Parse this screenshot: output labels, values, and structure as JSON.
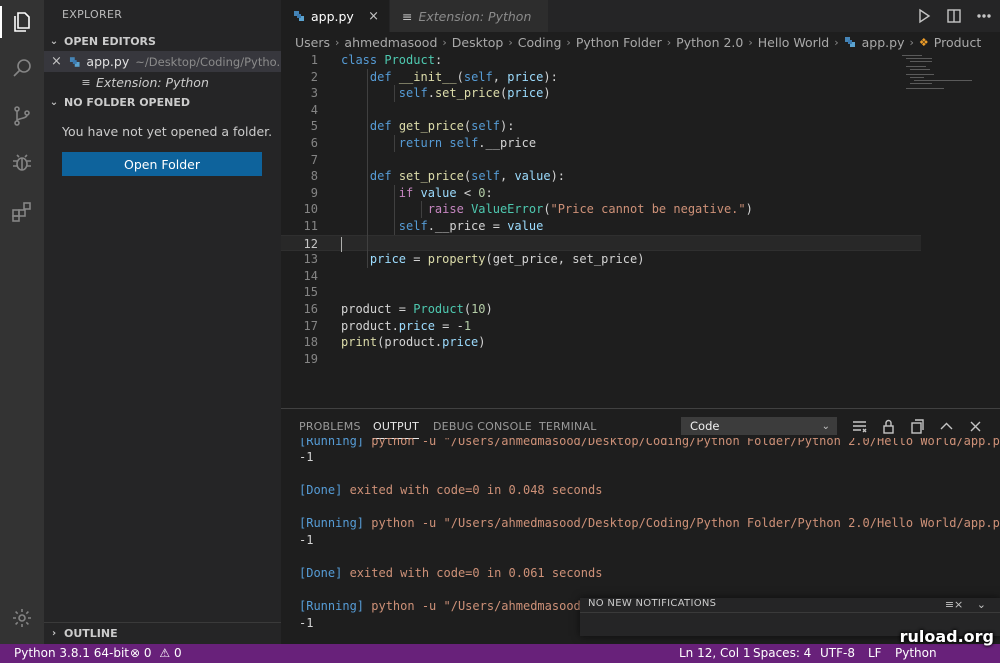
{
  "sidebar": {
    "title": "EXPLORER",
    "open_editors": {
      "header": "OPEN EDITORS",
      "items": [
        {
          "name": "app.py",
          "path": "~/Desktop/Coding/Pytho..."
        },
        {
          "name": "Extension: Python"
        }
      ]
    },
    "no_folder": {
      "header": "NO FOLDER OPENED",
      "message": "You have not yet opened a folder.",
      "button": "Open Folder"
    },
    "outline": "OUTLINE"
  },
  "tabs": [
    {
      "label": "app.py",
      "active": true
    },
    {
      "label": "Extension: Python",
      "active": false
    }
  ],
  "breadcrumb": [
    "Users",
    "ahmedmasood",
    "Desktop",
    "Coding",
    "Python Folder",
    "Python 2.0",
    "Hello World",
    "app.py",
    "Product"
  ],
  "code_lines": [
    "class Product:",
    "    def __init__(self, price):",
    "        self.set_price(price)",
    "",
    "    def get_price(self):",
    "        return self.__price",
    "",
    "    def set_price(self, value):",
    "        if value < 0:",
    "            raise ValueError(\"Price cannot be negative.\")",
    "        self.__price = value",
    "",
    "    price = property(get_price, set_price)",
    "",
    "",
    "product = Product(10)",
    "product.price = -1",
    "print(product.price)",
    ""
  ],
  "line_numbers": [
    "1",
    "2",
    "3",
    "4",
    "5",
    "6",
    "7",
    "8",
    "9",
    "10",
    "11",
    "12",
    "13",
    "14",
    "15",
    "16",
    "17",
    "18",
    "19"
  ],
  "panel": {
    "tabs": [
      "PROBLEMS",
      "OUTPUT",
      "DEBUG CONSOLE",
      "TERMINAL"
    ],
    "active_tab": "OUTPUT",
    "channel": "Code",
    "output": [
      {
        "tag": "[Running]",
        "text": " python -u \"/Users/ahmedmasood/Desktop/Coding/Python Folder/Python 2.0/Hello World/app.py\""
      },
      {
        "plain": "-1"
      },
      {
        "tag": "[Done]",
        "text": " exited with code=0 in 0.048 seconds"
      },
      {
        "tag": "[Running]",
        "text": " python -u \"/Users/ahmedmasood/Desktop/Coding/Python Folder/Python 2.0/Hello World/app.py\""
      },
      {
        "plain": "-1"
      },
      {
        "tag": "[Done]",
        "text": " exited with code=0 in 0.061 seconds"
      },
      {
        "tag": "[Running]",
        "text": " python -u \"/Users/ahmedmasood/De"
      },
      {
        "plain": "-1"
      }
    ]
  },
  "notification": {
    "title": "NO NEW NOTIFICATIONS"
  },
  "status": {
    "interpreter": "Python 3.8.1 64-bit",
    "errors": "0",
    "warnings": "0",
    "position": "Ln 12, Col 1",
    "spaces": "Spaces: 4",
    "encoding": "UTF-8",
    "eol": "LF",
    "language": "Python"
  },
  "watermark": "ruload.org",
  "colors": {
    "status_bar": "#68217a",
    "button": "#0e639c",
    "editor_bg": "#1e1e1e"
  }
}
